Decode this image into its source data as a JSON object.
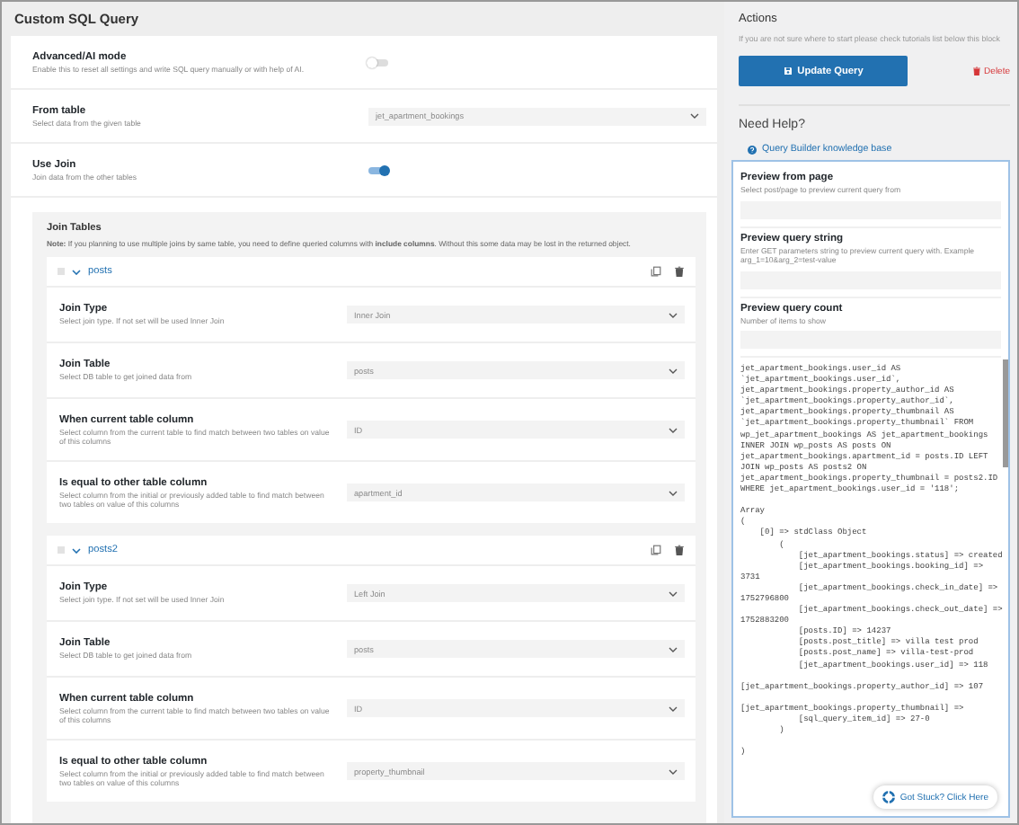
{
  "title": "Custom SQL Query",
  "settings": [
    {
      "kind": "toggle",
      "label": "Advanced/AI mode",
      "description": "Enable this to reset all settings and write SQL query manually or with help of AI.",
      "on": false
    },
    {
      "kind": "select",
      "label": "From table",
      "description": "Select data from the given table",
      "value": "jet_apartment_bookings"
    },
    {
      "kind": "toggle",
      "label": "Use Join",
      "description": "Join data from the other tables",
      "on": true
    }
  ],
  "join_tables": {
    "title": "Join Tables",
    "note": "**Note:** If you planning to use multiple joins by same table, you need to define queried columns with **include columns**. Without this some data may be lost in the returned object.",
    "items": [
      {
        "name": "posts",
        "expanded": true,
        "fields": [
          {
            "label": "Join Type",
            "description": "Select join type. If not set will be used Inner Join",
            "value": "Inner Join"
          },
          {
            "label": "Join Table",
            "description": "Select DB table to get joined data from",
            "value": "posts"
          },
          {
            "label": "When current table column",
            "description": "Select column from the current table to find match between two tables on value of this columns",
            "value": "ID"
          },
          {
            "label": "Is equal to other table column",
            "description": "Select column from the initial or previously added table to find match between two tables on value of this columns",
            "value": "apartment_id"
          }
        ]
      },
      {
        "name": "posts2",
        "expanded": true,
        "fields": [
          {
            "label": "Join Type",
            "description": "Select join type. If not set will be used Inner Join",
            "value": "Left Join"
          },
          {
            "label": "Join Table",
            "description": "Select DB table to get joined data from",
            "value": "posts"
          },
          {
            "label": "When current table column",
            "description": "Select column from the current table to find match between two tables on value of this columns",
            "value": "ID"
          },
          {
            "label": "Is equal to other table column",
            "description": "Select column from the initial or previously added table to find match between two tables on value of this columns",
            "value": "property_thumbnail"
          }
        ]
      }
    ]
  },
  "actions": {
    "title": "Actions",
    "description": "If you are not sure where to start please check tutorials list below this block",
    "update_button": "Update Query",
    "delete_button": "Delete"
  },
  "help": {
    "title": "Need Help?",
    "link": "Query Builder knowledge base"
  },
  "preview": {
    "fields": [
      {
        "label": "Preview from page",
        "description": "Select post/page to preview current query from"
      },
      {
        "label": "Preview query string",
        "description": "Enter GET parameters string to preview current query with. Example arg_1=10&arg_2=test-value"
      },
      {
        "label": "Preview query count",
        "description": "Number of items to show"
      }
    ],
    "output": "jet_apartment_bookings.user_id AS\n`jet_apartment_bookings.user_id`,\njet_apartment_bookings.property_author_id AS\n`jet_apartment_bookings.property_author_id`,\njet_apartment_bookings.property_thumbnail AS\n`jet_apartment_bookings.property_thumbnail` FROM\nwp_jet_apartment_bookings AS jet_apartment_bookings\nINNER JOIN wp_posts AS posts ON\njet_apartment_bookings.apartment_id = posts.ID LEFT\nJOIN wp_posts AS posts2 ON\njet_apartment_bookings.property_thumbnail = posts2.ID\nWHERE jet_apartment_bookings.user_id = '118';\n\nArray\n(\n    [0] => stdClass Object\n        (\n            [jet_apartment_bookings.status] => created\n            [jet_apartment_bookings.booking_id] =>\n3731\n            [jet_apartment_bookings.check_in_date] =>\n1752796800\n            [jet_apartment_bookings.check_out_date] =>\n1752883200\n            [posts.ID] => 14237\n            [posts.post_title] => villa test prod\n            [posts.post_name] => villa-test-prod\n            [jet_apartment_bookings.user_id] => 118\n\n[jet_apartment_bookings.property_author_id] => 107\n\n[jet_apartment_bookings.property_thumbnail] =>\n            [sql_query_item_id] => 27-0\n        )\n\n)"
  },
  "stuck_button": "Got Stuck? Click Here"
}
